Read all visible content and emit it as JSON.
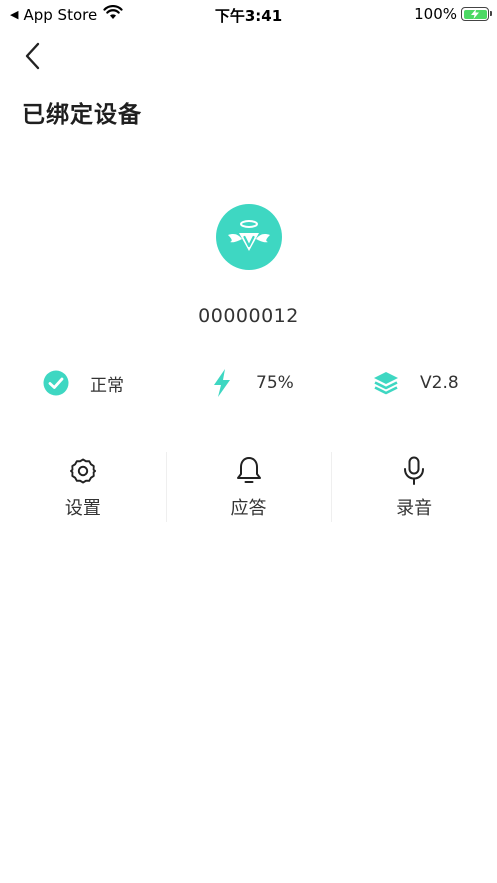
{
  "status_bar": {
    "back_app": "App Store",
    "time": "下午3:41",
    "battery": "100%"
  },
  "header": {
    "title": "已绑定设备"
  },
  "device": {
    "id": "00000012",
    "avatar_icon": "angel-v-logo-icon",
    "accent_color": "#3ed7c2"
  },
  "info": {
    "status": {
      "icon": "check-circle-icon",
      "label": "正常"
    },
    "battery": {
      "icon": "lightning-icon",
      "label": "75%"
    },
    "version": {
      "icon": "layers-icon",
      "label": "V2.8"
    }
  },
  "actions": [
    {
      "icon": "gear-icon",
      "label": "设置"
    },
    {
      "icon": "bell-icon",
      "label": "应答"
    },
    {
      "icon": "microphone-icon",
      "label": "录音"
    }
  ]
}
